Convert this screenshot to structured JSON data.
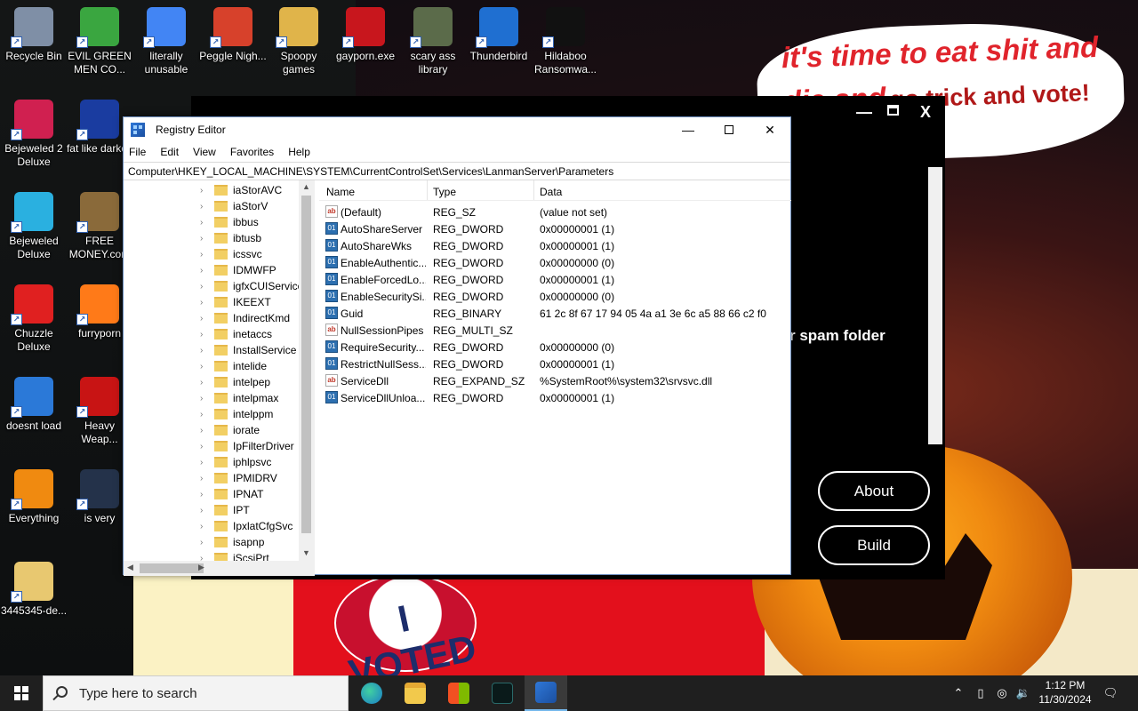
{
  "desktop": {
    "icons": [
      {
        "label": "Recycle Bin",
        "icon": "recycle-bin-icon",
        "color": "#7f8fa6"
      },
      {
        "label": "EVIL GREEN MEN CO...",
        "icon": "green-men-icon",
        "color": "#3aa640"
      },
      {
        "label": "literally unusable",
        "icon": "chrome-icon",
        "color": "#4285f4"
      },
      {
        "label": "Peggle Nigh...",
        "icon": "peggle-icon",
        "color": "#d7412b"
      },
      {
        "label": "Spoopy games",
        "icon": "folder-icon",
        "color": "#e0b44a"
      },
      {
        "label": "gayporn.exe",
        "icon": "flash-icon",
        "color": "#c8161d"
      },
      {
        "label": "scary ass library",
        "icon": "library-icon",
        "color": "#5b6b4a"
      },
      {
        "label": "Thunderbird",
        "icon": "thunderbird-icon",
        "color": "#1f6fd1"
      },
      {
        "label": "Hildaboo Ransomwa...",
        "icon": "yashma-icon",
        "color": "#111111"
      },
      {
        "label": "Bejeweled 2 Deluxe",
        "icon": "bejeweled2-icon",
        "color": "#d02050"
      },
      {
        "label": "fat like darkok",
        "icon": "mpj-icon",
        "color": "#1a3ca0"
      },
      {
        "label": "Bejeweled Deluxe",
        "icon": "gem-icon",
        "color": "#2ab0e0"
      },
      {
        "label": "FREE MONEY.com",
        "icon": "money-bag-icon",
        "color": "#8a6a3a"
      },
      {
        "label": "Chuzzle Deluxe",
        "icon": "chuzzle-icon",
        "color": "#e02020"
      },
      {
        "label": "furryporn",
        "icon": "firefox-icon",
        "color": "#ff7a18"
      },
      {
        "label": "doesnt load",
        "icon": "mail-icon",
        "color": "#2b79d8"
      },
      {
        "label": "Heavy Weap...",
        "icon": "radiation-icon",
        "color": "#c81414"
      },
      {
        "label": "Everything",
        "icon": "everything-search-icon",
        "color": "#f08a10"
      },
      {
        "label": "is very",
        "icon": "shield-mpj-icon",
        "color": "#24324a"
      },
      {
        "label": "3445345-de...",
        "icon": "zip-folder-icon",
        "color": "#e8c870"
      }
    ]
  },
  "wallpaper": {
    "bubble_red": "it's time to eat shit and die and",
    "bubble_dark": "go trick and vote!",
    "sticker": "I VOTED"
  },
  "bg_app": {
    "partial_text": "r spam folder",
    "about": "About",
    "build": "Build",
    "close": "X"
  },
  "regedit": {
    "title": "Registry Editor",
    "menu": [
      "File",
      "Edit",
      "View",
      "Favorites",
      "Help"
    ],
    "address": "Computer\\HKEY_LOCAL_MACHINE\\SYSTEM\\CurrentControlSet\\Services\\LanmanServer\\Parameters",
    "tree": [
      "iaStorAVC",
      "iaStorV",
      "ibbus",
      "ibtusb",
      "icssvc",
      "IDMWFP",
      "igfxCUIService",
      "IKEEXT",
      "IndirectKmd",
      "inetaccs",
      "InstallService",
      "intelide",
      "intelpep",
      "intelpmax",
      "intelppm",
      "iorate",
      "IpFilterDriver",
      "iphlpsvc",
      "IPMIDRV",
      "IPNAT",
      "IPT",
      "IpxlatCfgSvc",
      "isapnp",
      "iScsiPrt"
    ],
    "columns": {
      "name": "Name",
      "type": "Type",
      "data": "Data"
    },
    "values": [
      {
        "name": "(Default)",
        "type": "REG_SZ",
        "data": "(value not set)",
        "kind": "sz"
      },
      {
        "name": "AutoShareServer",
        "type": "REG_DWORD",
        "data": "0x00000001 (1)",
        "kind": "bin"
      },
      {
        "name": "AutoShareWks",
        "type": "REG_DWORD",
        "data": "0x00000001 (1)",
        "kind": "bin"
      },
      {
        "name": "EnableAuthentic...",
        "type": "REG_DWORD",
        "data": "0x00000000 (0)",
        "kind": "bin"
      },
      {
        "name": "EnableForcedLo...",
        "type": "REG_DWORD",
        "data": "0x00000001 (1)",
        "kind": "bin"
      },
      {
        "name": "EnableSecuritySi...",
        "type": "REG_DWORD",
        "data": "0x00000000 (0)",
        "kind": "bin"
      },
      {
        "name": "Guid",
        "type": "REG_BINARY",
        "data": "61 2c 8f 67 17 94 05 4a a1 3e 6c a5 88 66 c2 f0",
        "kind": "bin"
      },
      {
        "name": "NullSessionPipes",
        "type": "REG_MULTI_SZ",
        "data": "",
        "kind": "sz"
      },
      {
        "name": "RequireSecurity...",
        "type": "REG_DWORD",
        "data": "0x00000000 (0)",
        "kind": "bin"
      },
      {
        "name": "RestrictNullSess...",
        "type": "REG_DWORD",
        "data": "0x00000001 (1)",
        "kind": "bin"
      },
      {
        "name": "ServiceDll",
        "type": "REG_EXPAND_SZ",
        "data": "%SystemRoot%\\system32\\srvsvc.dll",
        "kind": "sz"
      },
      {
        "name": "ServiceDllUnloa...",
        "type": "REG_DWORD",
        "data": "0x00000001 (1)",
        "kind": "bin"
      }
    ]
  },
  "taskbar": {
    "search_placeholder": "Type here to search",
    "apps": [
      "edge-icon",
      "file-explorer-icon",
      "store-icon",
      "chaos-app-icon",
      "regedit-icon"
    ],
    "time": "1:12 PM",
    "date": "11/30/2024"
  }
}
